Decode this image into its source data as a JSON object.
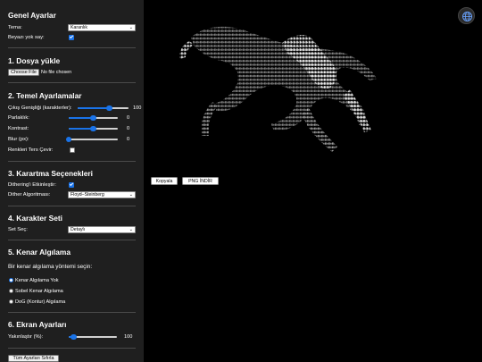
{
  "general": {
    "title": "Genel Ayarlar",
    "theme_label": "Tema:",
    "theme_value": "Karanlık",
    "ignore_white_label": "Beyazı yok say:",
    "ignore_white_checked": true
  },
  "upload": {
    "title": "1. Dosya yükle",
    "choose_label": "Choose File",
    "status": "No file chosen"
  },
  "basic": {
    "title": "2. Temel Ayarlamalar",
    "width_label": "Çıkış Genişliği (karakterler):",
    "width_value": "100",
    "width_level": 0.62,
    "brightness_label": "Parlaklık:",
    "brightness_value": "0",
    "brightness_level": 0.5,
    "contrast_label": "Kontrast:",
    "contrast_value": "0",
    "contrast_level": 0.5,
    "blur_label": "Blur (px):",
    "blur_value": "0",
    "blur_level": 0.0,
    "invert_label": "Renkleri Ters Çevir:",
    "invert_checked": false
  },
  "dither": {
    "title": "3. Karartma Seçenekleri",
    "enable_label": "Dithering'i Etkinleştir:",
    "enable_checked": true,
    "algo_label": "Dither Algoritması:",
    "algo_value": "Floyd–Steinberg"
  },
  "charset": {
    "title": "4. Karakter Seti",
    "label": "Set Seç:",
    "value": "Detaylı"
  },
  "edge": {
    "title": "5. Kenar Algılama",
    "prompt": "Bir kenar algılama yöntemi seçin:",
    "options": [
      "Kenar Algılama Yok",
      "Sobel Kenar Algılama",
      "DoG (Kontur) Algılama"
    ],
    "selected_index": 0
  },
  "display": {
    "title": "6. Ekran Ayarları",
    "zoom_label": "Yakınlaştır (%):",
    "zoom_value": "100",
    "zoom_level": 0.1
  },
  "reset_label": "Tüm Ayarları Sıfırla",
  "output": {
    "copy_label": "Kopyala",
    "png_label": "PNG İNDİR"
  },
  "icons": {
    "globe": "globe-icon"
  },
  "colors": {
    "accent": "#1a73e8",
    "sidebar_bg": "#1f1f1f",
    "canvas_bg": "#000000"
  }
}
